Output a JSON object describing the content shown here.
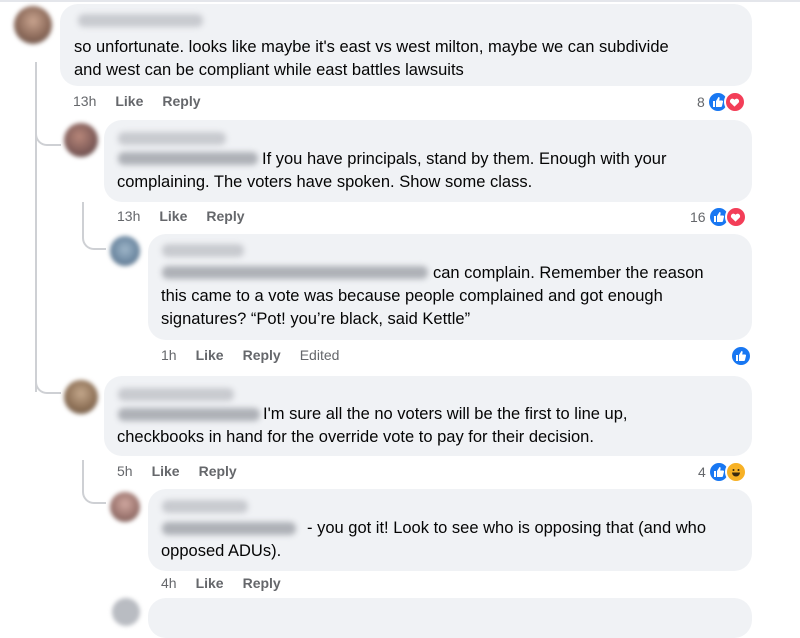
{
  "comments": [
    {
      "body": "so unfortunate. looks like maybe it's east vs west milton, maybe we can subdivide and west can be compliant while east battles lawsuits",
      "line1": "so unfortunate. looks like maybe it's east vs west milton, maybe we can subdivide",
      "line2": "and west can be compliant while east battles lawsuits",
      "time": "13h",
      "like": "Like",
      "reply": "Reply",
      "reactions": "8",
      "reaction_types": [
        "like",
        "love"
      ]
    },
    {
      "line1": "If you have principals, stand by them. Enough with your",
      "line2": "complaining. The voters have spoken. Show some class.",
      "time": "13h",
      "like": "Like",
      "reply": "Reply",
      "reactions": "16",
      "reaction_types": [
        "like",
        "love"
      ]
    },
    {
      "line1": "can complain. Remember the reason",
      "line2": "this came to a vote was because people complained and got enough",
      "line3": "signatures? “Pot! you’re black, said Kettle”",
      "time": "1h",
      "like": "Like",
      "reply": "Reply",
      "edited": "Edited",
      "reaction_types": [
        "like"
      ]
    },
    {
      "line1": "I'm sure all the no voters will be the first to line up,",
      "line2": "checkbooks in hand for the override vote to pay for their decision.",
      "time": "5h",
      "like": "Like",
      "reply": "Reply",
      "reactions": "4",
      "reaction_types": [
        "like",
        "haha"
      ]
    },
    {
      "line1": "- you got it! Look to see who is opposing that (and who",
      "line2": "opposed ADUs).",
      "time": "4h",
      "like": "Like",
      "reply": "Reply"
    }
  ],
  "colors": {
    "bubble": "#f0f2f5",
    "like_blue": "#1877f2",
    "love_red": "#f33e58",
    "haha_yellow": "#f7b125",
    "meta_gray": "#65676b"
  }
}
